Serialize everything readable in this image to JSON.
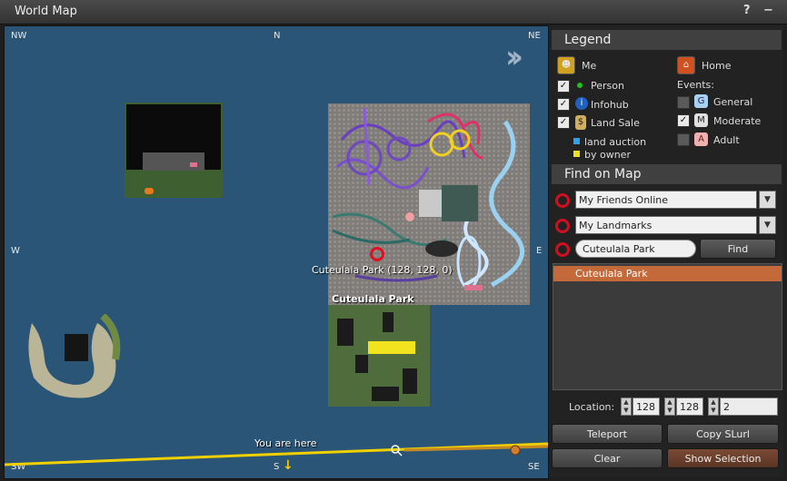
{
  "window": {
    "title": "World Map",
    "help": "?",
    "close": "−"
  },
  "map": {
    "compass": {
      "nw": "NW",
      "n": "N",
      "ne": "NE",
      "w": "W",
      "e": "E",
      "sw": "SW",
      "s": "S",
      "se": "SE"
    },
    "pin_label": "Cuteulala Park (128, 128, 0)",
    "region_label": "Cuteulala Park",
    "you_are_here": "You are here"
  },
  "legend": {
    "header": "Legend",
    "me": "Me",
    "home": "Home",
    "person": "Person",
    "infohub": "Infohub",
    "land_sale": "Land Sale",
    "land_auction": "land auction",
    "by_owner": "by owner",
    "events_label": "Events:",
    "general": "General",
    "moderate": "Moderate",
    "adult": "Adult",
    "general_letter": "G",
    "moderate_letter": "M",
    "adult_letter": "A",
    "checks": {
      "person": true,
      "infohub": true,
      "land_sale": true,
      "moderate": true,
      "general": false,
      "adult": false
    }
  },
  "find": {
    "header": "Find on Map",
    "friends_dropdown": "My Friends Online",
    "landmarks_dropdown": "My Landmarks",
    "search_value": "Cuteulala Park",
    "find_button": "Find",
    "results": [
      "Cuteulala Park"
    ],
    "location_label": "Location:",
    "loc_x": "128",
    "loc_y": "128",
    "loc_z": "2",
    "teleport": "Teleport",
    "copy_slurl": "Copy SLurl",
    "clear": "Clear",
    "show_selection": "Show Selection"
  },
  "colors": {
    "accent": "#c46a3a",
    "pin": "#e01020",
    "water": "#2a5577",
    "zoom_line": "#f0d000"
  }
}
